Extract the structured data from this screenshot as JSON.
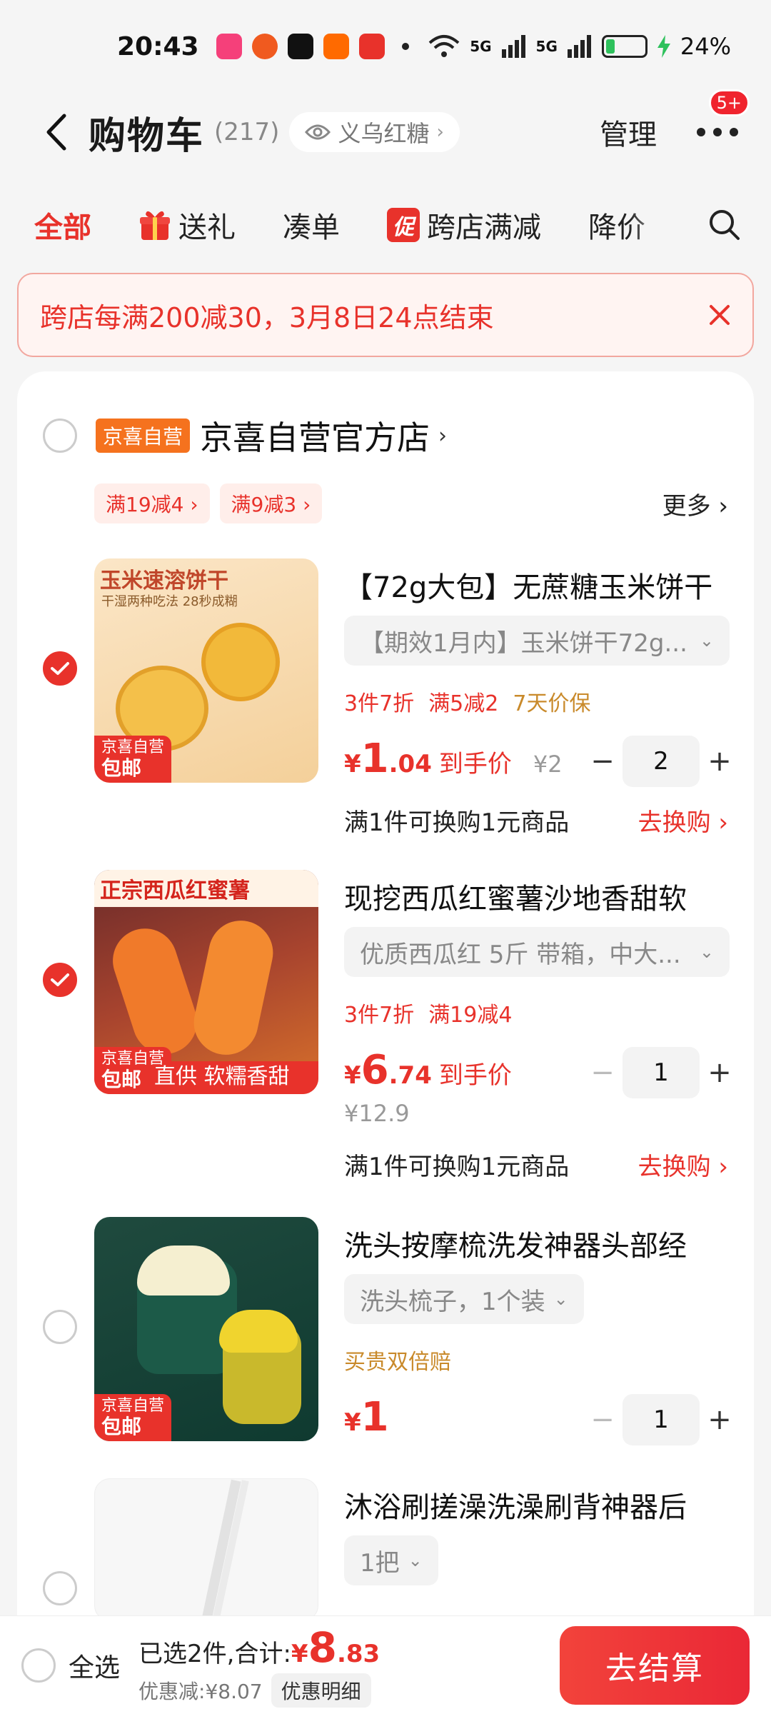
{
  "status": {
    "time": "20:43",
    "battery": "24%",
    "battery_level": 0.24,
    "network1": "5G",
    "network2": "5G"
  },
  "header": {
    "title": "购物车",
    "count": "(217)",
    "location": "义乌红糖",
    "manage": "管理",
    "badge": "5+"
  },
  "tabs": [
    {
      "label": "全部"
    },
    {
      "label": "送礼"
    },
    {
      "label": "凑单"
    },
    {
      "label": "跨店满减",
      "tag": "促"
    },
    {
      "label": "降价"
    }
  ],
  "banner": {
    "text": "跨店每满200减30，3月8日24点结束"
  },
  "shop": {
    "badge": "京喜自营",
    "name": "京喜自营官方店",
    "coupons": [
      "满19减4 ›",
      "满9减3 ›"
    ],
    "more": "更多 ›"
  },
  "items": [
    {
      "title": "【72g大包】无蔗糖玉米饼干",
      "sku": "【期效1月内】玉米饼干72g...",
      "tags": [
        "3件7折",
        "满5减2"
      ],
      "tag_gold": "7天价保",
      "price_int": "1",
      "price_dec": ".04",
      "price_note": "到手价",
      "orig_price": "¥2",
      "qty": "2",
      "exchange": "满1件可换购1元商品",
      "exchange_link": "去换购 ›",
      "thumb_title": "玉米速溶饼干",
      "thumb_sub": "干湿两种吃法 28秒成糊",
      "checked": true
    },
    {
      "title": "现挖西瓜红蜜薯沙地香甜软",
      "sku": "优质西瓜红 5斤 带箱，中大...",
      "tags": [
        "3件7折",
        "满19减4"
      ],
      "price_int": "6",
      "price_dec": ".74",
      "price_note": "到手价",
      "orig_price": "¥12.9",
      "qty": "1",
      "exchange": "满1件可换购1元商品",
      "exchange_link": "去换购 ›",
      "thumb_title": "正宗西瓜红蜜薯",
      "thumb_sub": "直供 软糯香甜",
      "checked": true
    },
    {
      "title": "洗头按摩梳洗发神器头部经",
      "sku": "洗头梳子，1个装",
      "tag_gold": "买贵双倍赔",
      "price_int": "1",
      "qty": "1",
      "checked": false
    },
    {
      "title": "沐浴刷搓澡洗澡刷背神器后",
      "sku": "1把",
      "checked": false
    }
  ],
  "thumb_badge": {
    "line1": "京喜自营",
    "line2": "包邮"
  },
  "footer": {
    "select_all": "全选",
    "selected_text": "已选2件,合计:",
    "total_yen": "¥",
    "total_int": "8",
    "total_dec": ".83",
    "discount": "优惠减:¥8.07",
    "detail": "优惠明细",
    "checkout": "去结算"
  },
  "colors": {
    "accent": "#e8322b",
    "gold": "#c98a2b"
  }
}
